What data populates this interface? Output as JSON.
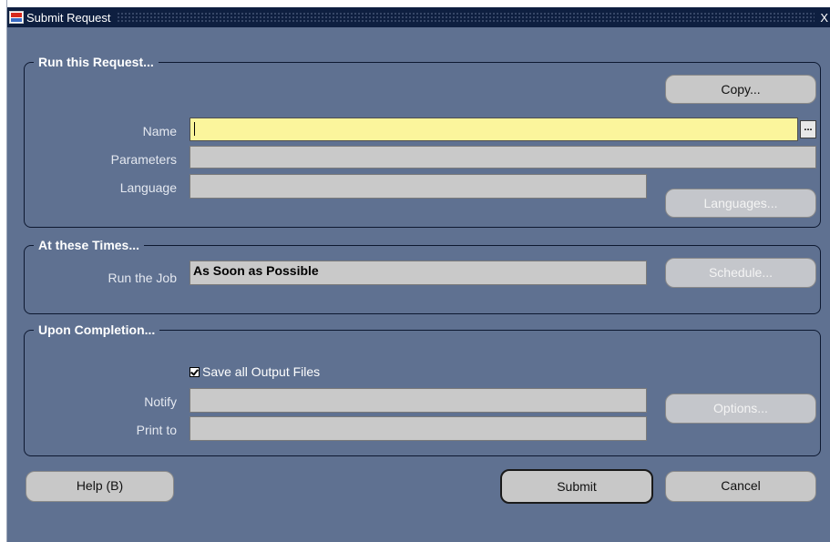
{
  "window": {
    "title": "Submit Request",
    "close_glyph": "X",
    "icon": "oracle-app-icon"
  },
  "run_request": {
    "title": "Run this Request...",
    "copy_button": "Copy...",
    "name_label": "Name",
    "name_value": "",
    "lov_button": "...",
    "parameters_label": "Parameters",
    "parameters_value": "",
    "language_label": "Language",
    "language_value": "",
    "languages_button": "Languages..."
  },
  "times": {
    "title": "At these Times...",
    "run_job_label": "Run the Job",
    "run_job_value": "As Soon as Possible",
    "schedule_button": "Schedule..."
  },
  "completion": {
    "title": "Upon Completion...",
    "save_output_label": "Save all Output Files",
    "save_output_checked": true,
    "notify_label": "Notify",
    "notify_value": "",
    "print_to_label": "Print to",
    "print_to_value": "",
    "options_button": "Options..."
  },
  "footer": {
    "help_button": "Help (B)",
    "submit_button": "Submit",
    "cancel_button": "Cancel"
  },
  "colors": {
    "window_bg": "#5f7191",
    "titlebar_bg": "#0e1f40",
    "active_field_bg": "#fbf59c",
    "field_bg": "#c9c9c9"
  }
}
